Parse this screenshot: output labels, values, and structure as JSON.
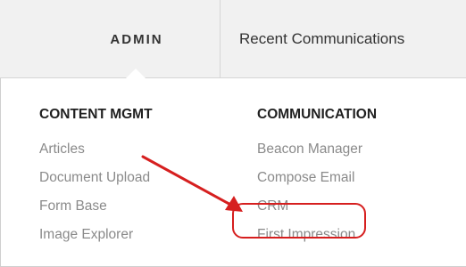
{
  "topnav": {
    "admin_label": "ADMIN",
    "recent_label": "Recent Communications"
  },
  "menu": {
    "content_mgmt": {
      "heading": "CONTENT MGMT",
      "items": [
        "Articles",
        "Document Upload",
        "Form Base",
        "Image Explorer"
      ]
    },
    "communication": {
      "heading": "COMMUNICATION",
      "items": [
        "Beacon Manager",
        "Compose Email",
        "CRM",
        "First Impression"
      ]
    }
  },
  "annotation": {
    "color": "#d61f1f",
    "highlighted_item": "CRM"
  }
}
